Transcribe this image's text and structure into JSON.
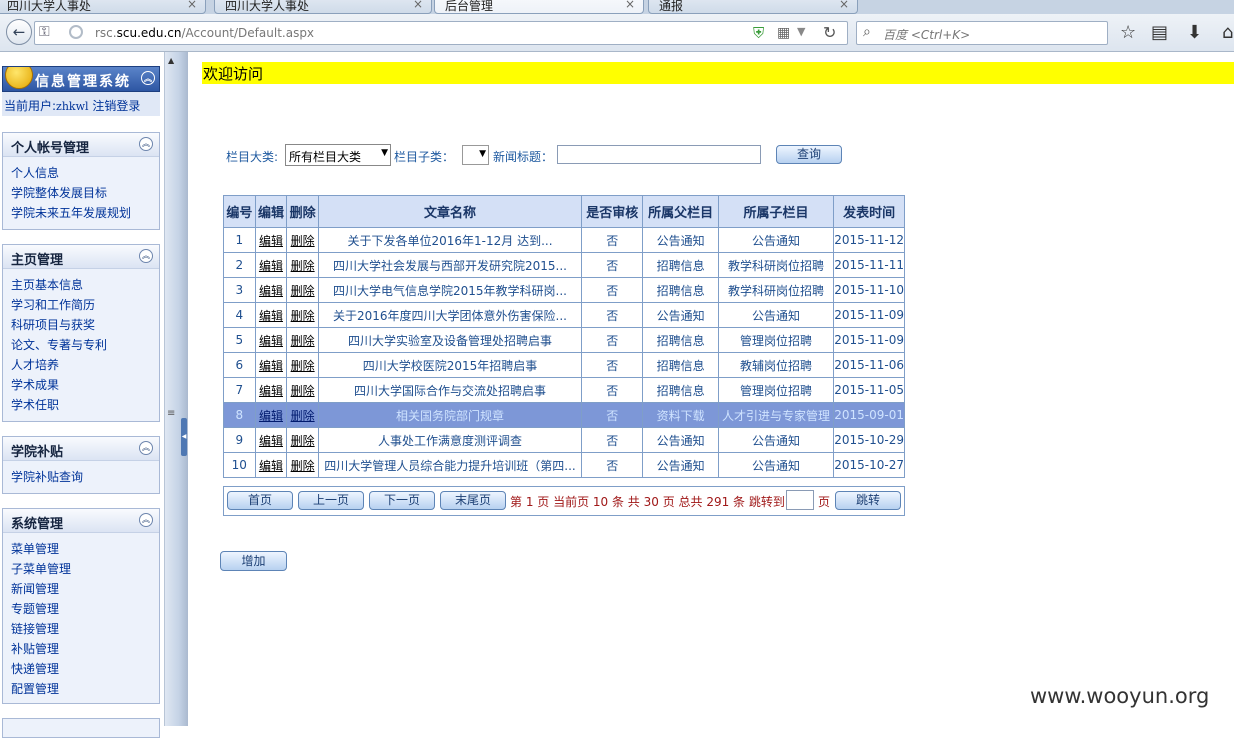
{
  "browser": {
    "tabs": [
      {
        "label": "四川大学人事处"
      },
      {
        "label": "四川大学人事处"
      },
      {
        "label": "后台管理"
      },
      {
        "label": "通报"
      }
    ],
    "tab_close": "×",
    "url_host_prefix": "rsc.",
    "url_host_main": "scu.edu.cn",
    "url_path": "/Account/Default.aspx",
    "search_placeholder": "百度 <Ctrl+K>"
  },
  "sidebar": {
    "logo_text": "信息管理系统",
    "current_user_label": "当前用户:",
    "current_user": "zhkwl",
    "logout": "注销登录",
    "sections": [
      {
        "title": "个人帐号管理",
        "items": [
          "个人信息",
          "学院整体发展目标",
          "学院未来五年发展规划"
        ]
      },
      {
        "title": "主页管理",
        "items": [
          "主页基本信息",
          "学习和工作简历",
          "科研项目与获奖",
          "论文、专著与专利",
          "人才培养",
          "学术成果",
          "学术任职"
        ]
      },
      {
        "title": "学院补贴",
        "items": [
          "学院补贴查询"
        ]
      },
      {
        "title": "系统管理",
        "items": [
          "菜单管理",
          "子菜单管理",
          "新闻管理",
          "专题管理",
          "链接管理",
          "补贴管理",
          "快递管理",
          "配置管理"
        ]
      }
    ]
  },
  "main": {
    "welcome": "欢迎访问",
    "filters": {
      "category_label": "栏目大类:",
      "category_value": "所有栏目大类",
      "subcategory_label": "栏目子类：",
      "title_label": "新闻标题：",
      "query_button": "查询"
    },
    "table": {
      "headers": [
        "编号",
        "编辑",
        "删除",
        "文章名称",
        "是否审核",
        "所属父栏目",
        "所属子栏目",
        "发表时间"
      ],
      "edit_label": "编辑",
      "delete_label": "删除",
      "rows": [
        {
          "id": "1",
          "title": "关于下发各单位2016年1-12月 达到...",
          "reviewed": "否",
          "parent": "公告通知",
          "child": "公告通知",
          "date": "2015-11-12"
        },
        {
          "id": "2",
          "title": "四川大学社会发展与西部开发研究院2015...",
          "reviewed": "否",
          "parent": "招聘信息",
          "child": "教学科研岗位招聘",
          "date": "2015-11-11"
        },
        {
          "id": "3",
          "title": "四川大学电气信息学院2015年教学科研岗...",
          "reviewed": "否",
          "parent": "招聘信息",
          "child": "教学科研岗位招聘",
          "date": "2015-11-10"
        },
        {
          "id": "4",
          "title": "关于2016年度四川大学团体意外伤害保险...",
          "reviewed": "否",
          "parent": "公告通知",
          "child": "公告通知",
          "date": "2015-11-09"
        },
        {
          "id": "5",
          "title": "四川大学实验室及设备管理处招聘启事",
          "reviewed": "否",
          "parent": "招聘信息",
          "child": "管理岗位招聘",
          "date": "2015-11-09"
        },
        {
          "id": "6",
          "title": "四川大学校医院2015年招聘启事",
          "reviewed": "否",
          "parent": "招聘信息",
          "child": "教辅岗位招聘",
          "date": "2015-11-06"
        },
        {
          "id": "7",
          "title": "四川大学国际合作与交流处招聘启事",
          "reviewed": "否",
          "parent": "招聘信息",
          "child": "管理岗位招聘",
          "date": "2015-11-05"
        },
        {
          "id": "8",
          "title": "相关国务院部门规章",
          "reviewed": "否",
          "parent": "资料下载",
          "child": "人才引进与专家管理",
          "date": "2015-09-01"
        },
        {
          "id": "9",
          "title": "人事处工作满意度测评调查",
          "reviewed": "否",
          "parent": "公告通知",
          "child": "公告通知",
          "date": "2015-10-29"
        },
        {
          "id": "10",
          "title": "四川大学管理人员综合能力提升培训班（第四...",
          "reviewed": "否",
          "parent": "公告通知",
          "child": "公告通知",
          "date": "2015-10-27"
        }
      ]
    },
    "pager": {
      "first": "首页",
      "prev": "上一页",
      "next": "下一页",
      "last": "末尾页",
      "info": "第 1 页 当前页 10 条 共 30 页 总共 291 条 跳转到",
      "unit": "页",
      "jump": "跳转"
    },
    "add_button": "增加"
  },
  "watermark": "www.wooyun.org",
  "colors": {
    "welcome_bg": "#ffff00",
    "selected_row": "#7d97d7",
    "link_blue": "#003399"
  }
}
